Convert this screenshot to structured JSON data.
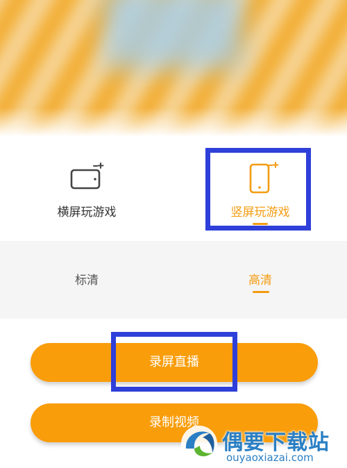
{
  "orientation": {
    "landscape_label": "横屏玩游戏",
    "portrait_label": "竖屏玩游戏",
    "selected": "portrait"
  },
  "quality": {
    "sd_label": "标清",
    "hd_label": "高清",
    "selected": "hd"
  },
  "actions": {
    "record_live_label": "录屏直播",
    "record_video_label": "录制视频"
  },
  "watermark": {
    "brand": "偶要下载站",
    "domain": "ouyaoxiazai.com"
  },
  "colors": {
    "accent": "#f39c12",
    "button": "#f99d0a",
    "highlight_box": "#2f3fd9",
    "quality_bg": "#f5f5f5",
    "brand_blue": "#2a7fc4"
  },
  "icons": {
    "landscape": "landscape-phone-rotate-icon",
    "portrait": "portrait-phone-rotate-icon",
    "logo": "ouyao-logo-icon"
  }
}
